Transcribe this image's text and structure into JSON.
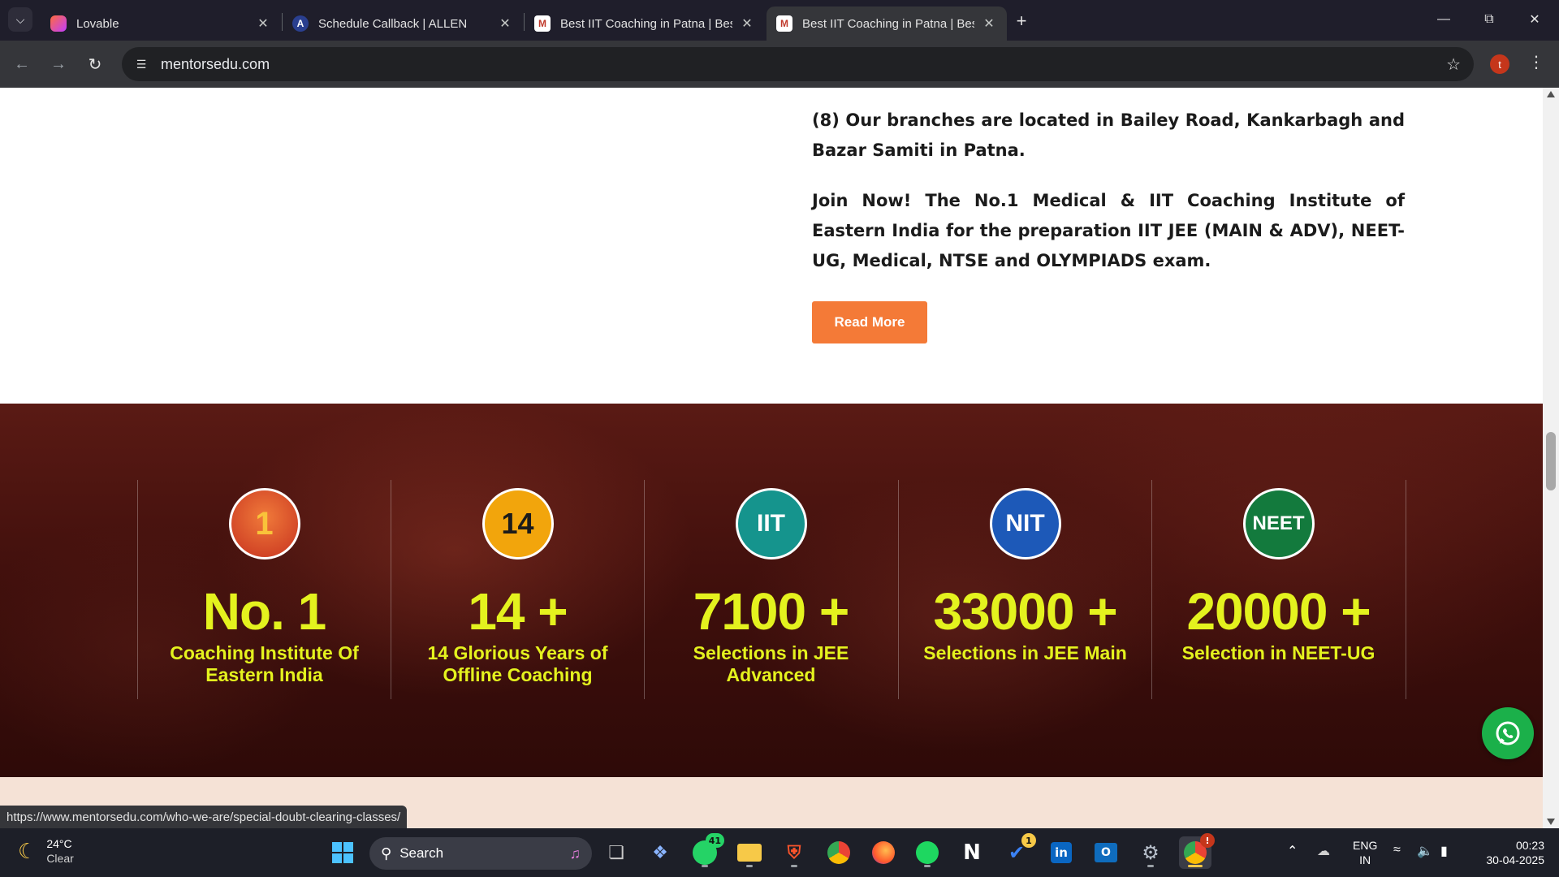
{
  "browser": {
    "tabs": [
      {
        "title": "Lovable",
        "icon": "lovable-icon",
        "active": false
      },
      {
        "title": "Schedule Callback | ALLEN",
        "icon": "allen-icon",
        "active": false
      },
      {
        "title": "Best IIT Coaching in Patna | Best",
        "icon": "mentors-icon",
        "active": false
      },
      {
        "title": "Best IIT Coaching in Patna | Best",
        "icon": "mentors-icon",
        "active": true
      }
    ],
    "url": "mentorsedu.com",
    "profile_initial": "t"
  },
  "page": {
    "about_paragraphs": [
      "(8) Our branches are located in Bailey Road, Kankarbagh and Bazar Samiti in Patna.",
      "Join Now! The No.1 Medical & IIT Coaching Institute of Eastern India for the preparation IIT JEE (MAIN & ADV), NEET-UG, Medical, NTSE and OLYMPIADS exam."
    ],
    "read_more_label": "Read More",
    "stats": [
      {
        "badge": "1",
        "number": "No. 1",
        "label": "Coaching Institute Of Eastern India",
        "badge_color": "#d9452b"
      },
      {
        "badge": "14",
        "number": "14 +",
        "label": "14 Glorious Years of Offline Coaching",
        "badge_color": "#f2a50c"
      },
      {
        "badge": "IIT",
        "number": "7100 +",
        "label": "Selections in JEE Advanced",
        "badge_color": "#15948d"
      },
      {
        "badge": "NIT",
        "number": "33000 +",
        "label": "Selections in JEE Main",
        "badge_color": "#1d59b8"
      },
      {
        "badge": "NEET",
        "number": "20000 +",
        "label": "Selection in NEET-UG",
        "badge_color": "#137a3d"
      }
    ],
    "hover_status_url": "https://www.mentorsedu.com/who-we-are/special-doubt-clearing-classes/",
    "accent_color": "#f47a37",
    "stat_text_color": "#e4f21e"
  },
  "taskbar": {
    "weather_temp": "24°C",
    "weather_desc": "Clear",
    "search_label": "Search",
    "whatsapp_badge": "41",
    "todo_badge": "1",
    "chrome_badge": "!",
    "lang_line1": "ENG",
    "lang_line2": "IN",
    "time": "00:23",
    "date": "30-04-2025"
  }
}
